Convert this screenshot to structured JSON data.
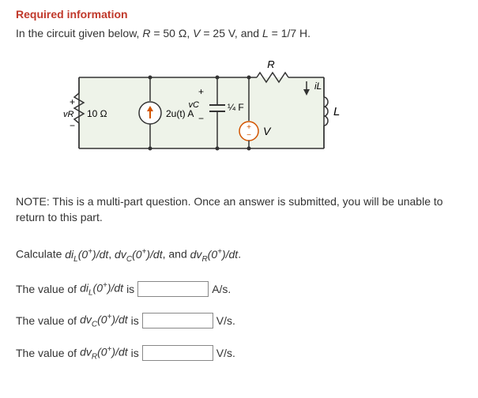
{
  "heading": "Required information",
  "intro_prefix": "In the circuit given below, ",
  "intro_Rvar": "R",
  "intro_Req": " = 50 Ω, ",
  "intro_Vvar": "V",
  "intro_Veq": " = 25 V, and ",
  "intro_Lvar": "L",
  "intro_Leq": " = 1/7 H.",
  "circuit": {
    "R_top": "R",
    "iL": "iL",
    "vC_label": "vC",
    "cap_val": "¼ F",
    "vR_label": "vR",
    "res_val": "10 Ω",
    "source": "2u(t) A",
    "V_src": "V",
    "L_label": "L",
    "plus": "+",
    "minus": "−"
  },
  "note": "NOTE: This is a multi-part question. Once an answer is submitted, you will be unable to return to this part.",
  "calc_prefix": "Calculate ",
  "calc_sep1": ", ",
  "calc_sep2": ", and ",
  "calc_suffix": ".",
  "calc_t1a": "di",
  "calc_t1b": "L",
  "calc_t1c": "(0",
  "calc_t1d": "+",
  "calc_t1e": ")/dt",
  "calc_t2a": "dv",
  "calc_t2b": "C",
  "calc_t2c": "(0",
  "calc_t2d": "+",
  "calc_t2e": ")/dt",
  "calc_t3a": "dv",
  "calc_t3b": "R",
  "calc_t3c": "(0",
  "calc_t3d": "+",
  "calc_t3e": ")/dt",
  "q1_pre": "The value of ",
  "q1_mid": " is ",
  "q1_unit": " A/s.",
  "q2_pre": "The value of ",
  "q2_mid": " is ",
  "q2_unit": " V/s.",
  "q3_pre": "The value of ",
  "q3_mid": " is ",
  "q3_unit": " V/s.",
  "chart_data": {
    "type": "circuit",
    "components": [
      {
        "type": "resistor",
        "label": "10 Ω",
        "voltage": "vR"
      },
      {
        "type": "current_source",
        "label": "2u(t) A",
        "direction": "up"
      },
      {
        "type": "capacitor",
        "label": "1/4 F",
        "voltage": "vC"
      },
      {
        "type": "voltage_source",
        "label": "V"
      },
      {
        "type": "resistor",
        "label": "R",
        "position": "top-right"
      },
      {
        "type": "inductor",
        "label": "L",
        "current": "iL"
      }
    ],
    "parameters": {
      "R": "50 Ω",
      "V": "25 V",
      "L": "1/7 H"
    }
  }
}
